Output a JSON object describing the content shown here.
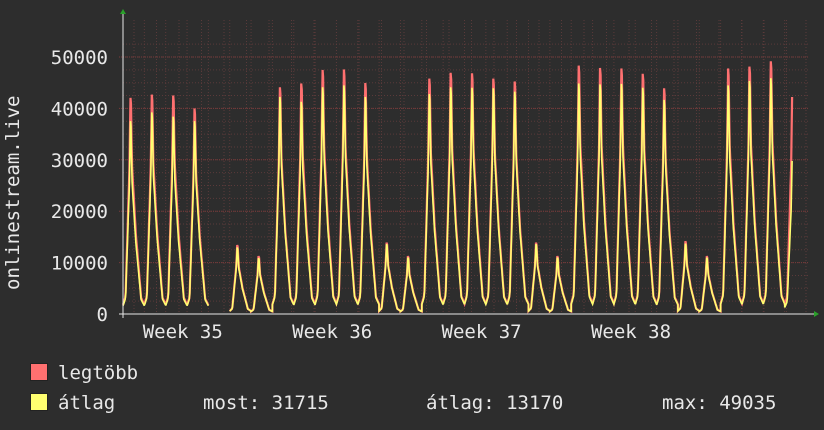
{
  "chart_data": {
    "type": "area",
    "ylabel": "onlinestream.live",
    "yticks": [
      0,
      10000,
      20000,
      30000,
      40000,
      50000
    ],
    "ylim": [
      0,
      55000
    ],
    "xticks": [
      "Week 35",
      "Week 36",
      "Week 37",
      "Week 38"
    ],
    "grid": true,
    "daily_peaks": {
      "max": [
        44800,
        45500,
        45300,
        42600,
        0,
        14300,
        12000,
        47000,
        47800,
        50600,
        50700,
        47900,
        14800,
        12000,
        48800,
        50000,
        49900,
        48800,
        48200,
        14800,
        12000,
        51500,
        51000,
        50900,
        49800,
        46800,
        15100,
        12000,
        50900,
        51300,
        52400,
        45000
      ],
      "avg": [
        40000,
        41800,
        40900,
        40000,
        0,
        13800,
        11600,
        45000,
        44000,
        47000,
        47400,
        45000,
        14500,
        11700,
        45600,
        47000,
        46900,
        46800,
        46100,
        14500,
        11700,
        47800,
        47600,
        47700,
        46900,
        44400,
        14600,
        11700,
        47400,
        48300,
        48900,
        31715
      ]
    },
    "series": [
      {
        "name": "legtöbb",
        "color": "#ff7070"
      },
      {
        "name": "átlag",
        "color": "#ffff70"
      }
    ]
  },
  "legend": {
    "max_label": "legtöbb",
    "avg_label": "átlag"
  },
  "stats": {
    "now": "most: 31715",
    "avg": "átlag: 13170",
    "max": "max: 49035"
  },
  "colors": {
    "background": "#2d2d2d",
    "plot_bg": "#2d2d2d",
    "grid": "#5a3a3a",
    "max": "#ff7070",
    "avg": "#ffff70",
    "text": "#e8e8e8"
  }
}
